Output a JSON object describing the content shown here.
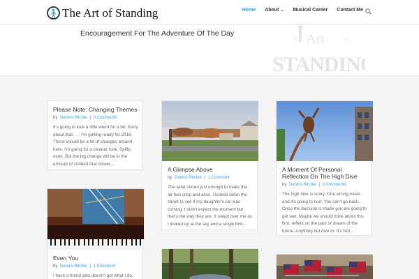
{
  "site": {
    "title": "The Art of Standing",
    "tagline": "Encouragement For The Adventure Of The Day",
    "watermark_text": "The Art of STANDING"
  },
  "nav": {
    "items": [
      {
        "label": "Home",
        "active": true,
        "has_submenu": false
      },
      {
        "label": "About",
        "active": false,
        "has_submenu": true
      },
      {
        "label": "Musical Career",
        "active": false,
        "has_submenu": false
      },
      {
        "label": "Contact Me",
        "active": false,
        "has_submenu": false
      }
    ],
    "search_icon": "search-icon"
  },
  "colors": {
    "accent": "#2ea3f2",
    "text": "#333333",
    "muted": "#666666"
  },
  "posts": [
    {
      "title": "Please Note: Changing Themes",
      "author": "Dennis Ritchie",
      "comments": "0 Comments",
      "excerpt": "It's going to look a little weird for a bit. Sorry about that . . . I'm getting ready for 2016. There should be a lot of changes around here. I'm going for a cleaner look. Spiffy, even. But the big change will be in the amount of content that shows..."
    },
    {
      "title": "A Glimpse Above",
      "author": "Dennis Ritchie",
      "comments": "1 Comment",
      "excerpt": "The wind stirred just enough to make the air feel crisp and alive. I looked down the street to see if my daughter's car was coming. I didn't expect the moment but that's the way they are. It swept over me as I looked up at the sky and a single bird..."
    },
    {
      "title": "A Moment Of Personal Reflection On The High Dive",
      "author": "Dennis Ritchie",
      "comments": "0 Comments",
      "excerpt": "The high dive is scary. One wrong move and it's going to hurt. You can't go back. Once the decision is made you are going to get wet. Maybe we should think about this first, reflect on the past or dream of the future. Anything but dive in. It's Not..."
    },
    {
      "title": "Even You",
      "author": "Dennis Ritchie",
      "comments": "1 Comment",
      "excerpt": "I have a friend who doesn't get what I do."
    }
  ],
  "meta_prefix": "by",
  "meta_separator": "|"
}
